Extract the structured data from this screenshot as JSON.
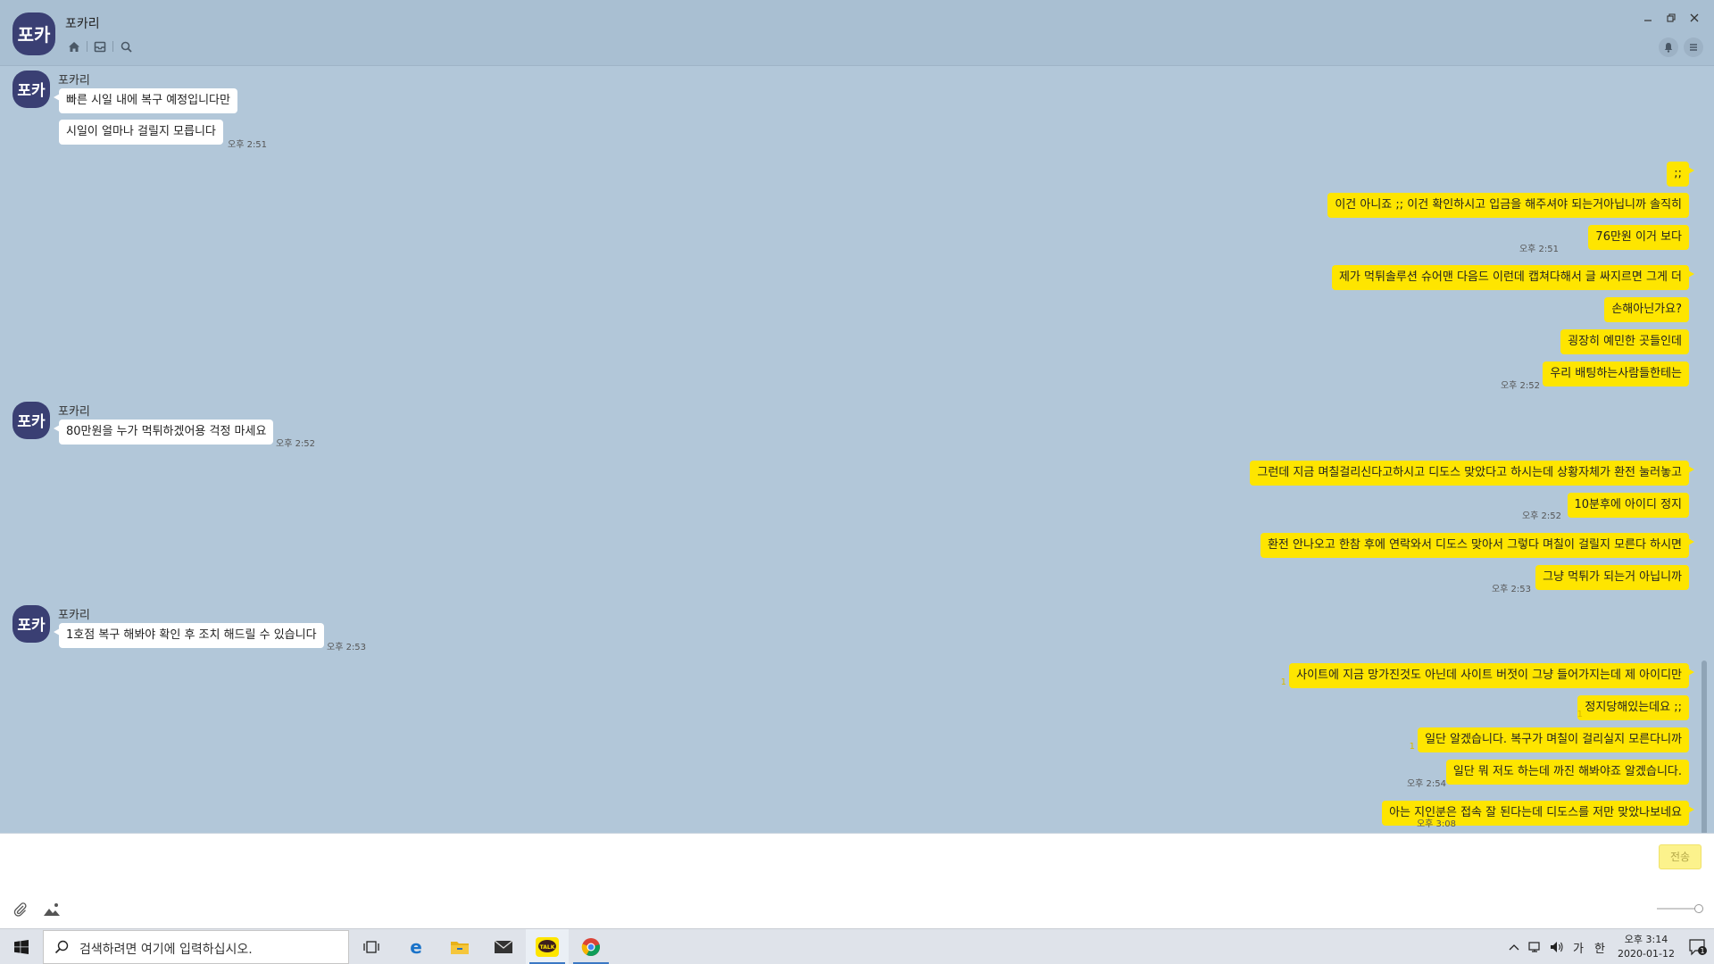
{
  "window": {
    "title": "포카리",
    "avatar_text": "포카"
  },
  "chat": {
    "sender_name": "포카리",
    "messages": [
      {
        "side": "in",
        "text": "빠른 시일 내에 복구 예정입니다만"
      },
      {
        "side": "in",
        "text": "시일이 얼마나 걸릴지 모릅니다",
        "time": "오후 2:51"
      },
      {
        "side": "out",
        "text": ";;"
      },
      {
        "side": "out",
        "text": "이건 아니죠 ;; 이건 확인하시고 입금을 해주셔야 되는거아닙니까 솔직히"
      },
      {
        "side": "out",
        "text": "76만원 이거 보다",
        "time": "오후 2:51"
      },
      {
        "side": "out",
        "text": "제가 먹튀솔루션 슈어맨 다음드 이런데 캡쳐다해서 글 싸지르면 그게 더"
      },
      {
        "side": "out",
        "text": "손해아닌가요?"
      },
      {
        "side": "out",
        "text": "굉장히 예민한 곳들인데"
      },
      {
        "side": "out",
        "text": "우리 배팅하는사람들한테는",
        "time": "오후 2:52"
      },
      {
        "side": "in",
        "text": "80만원을 누가 먹튀하겠어용 걱정 마세요",
        "time": "오후 2:52"
      },
      {
        "side": "out",
        "text": "그런데 지금 며칠걸리신다고하시고 디도스 맞았다고 하시는데 상황자체가 환전 눌러놓고"
      },
      {
        "side": "out",
        "text": "10분후에 아이디 정지",
        "time": "오후 2:52"
      },
      {
        "side": "out",
        "text": "환전 안나오고 한참 후에 연락와서 디도스 맞아서 그렇다 며칠이 걸릴지 모른다 하시면"
      },
      {
        "side": "out",
        "text": "그냥 먹튀가 되는거 아닙니까",
        "time": "오후 2:53"
      },
      {
        "side": "in",
        "text": "1호점 복구 해봐야 확인 후 조치 해드릴 수 있습니다",
        "time": "오후 2:53"
      },
      {
        "side": "out",
        "text": "사이트에 지금 망가진것도 아닌데 사이트 버젓이 그냥 들어가지는데 제 아이디만",
        "unread": "1"
      },
      {
        "side": "out",
        "text": "정지당해있는데요 ;;",
        "unread": "1"
      },
      {
        "side": "out",
        "text": "일단 알겠습니다. 복구가 며칠이 걸리실지 모른다니까",
        "unread": "1"
      },
      {
        "side": "out",
        "text": "일단 뭐 저도 하는데 까진 해봐야죠 알겠습니다.",
        "time": "오후 2:54"
      },
      {
        "side": "out",
        "text": "아는 지인분은 접속 잘 된다는데 디도스를 저만 맞았나보네요",
        "time": "오후 3:08",
        "unread": "1"
      }
    ]
  },
  "input": {
    "value": "",
    "send_label": "전송"
  },
  "taskbar": {
    "search_placeholder": "검색하려면 여기에 입력하십시오.",
    "ime_lang": "가",
    "ime_mode": "한",
    "time": "오후 3:14",
    "date": "2020-01-12",
    "notification_count": "1",
    "kakao_label": "TALK"
  },
  "colors": {
    "chat_bg": "#b2c7d9",
    "bubble_out": "#fee500",
    "bubble_in": "#ffffff",
    "titlebar_bg": "#a9bfd2"
  }
}
